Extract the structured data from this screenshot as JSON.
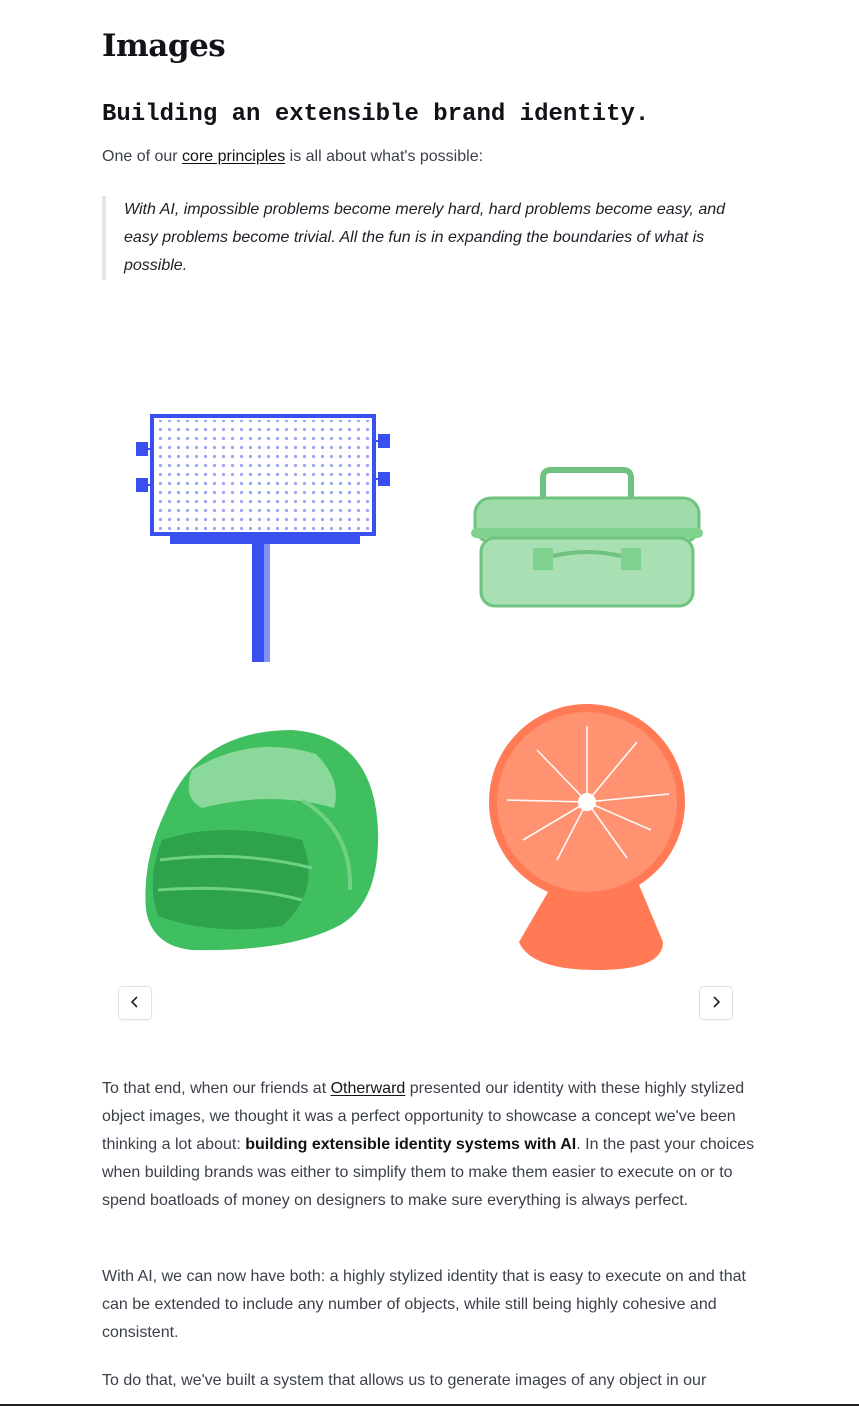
{
  "page": {
    "title": "Images",
    "section_heading": "Building an extensible brand identity.",
    "intro": {
      "before": "One of our ",
      "link": "core principles",
      "after": " is all about what's possible:"
    },
    "quote": "With AI, impossible problems become merely hard, hard problems become easy, and easy problems become trivial. All the fun is in expanding the boundaries of what is possible."
  },
  "carousel": {
    "items": [
      {
        "icon": "billboard-illustration",
        "color": "#3a4ff0"
      },
      {
        "icon": "toolbox-illustration",
        "color": "#7fd18e"
      },
      {
        "icon": "helmet-illustration",
        "color": "#3fbf5f"
      },
      {
        "icon": "plasma-ball-illustration",
        "color": "#ff7a55"
      }
    ],
    "prev_icon": "chevron-left-icon",
    "next_icon": "chevron-right-icon"
  },
  "body": {
    "p1": {
      "a": "To that end, when our friends at ",
      "link": "Otherward",
      "b": " presented our identity with these highly stylized object images, we thought it was a perfect opportunity to showcase a concept we've been thinking a lot about: ",
      "strong": "building extensible identity systems with AI",
      "c": ". In the past your choices when building brands was either to simplify them to make them easier to execute on or to spend boatloads of money on designers to make sure everything is always perfect."
    },
    "p2": "With AI, we can now have both: a highly stylized identity that is easy to execute on and that can be extended to include any number of objects, while still being highly cohesive and consistent.",
    "p3": "To do that, we've built a system that allows us to generate images of any object in our"
  }
}
